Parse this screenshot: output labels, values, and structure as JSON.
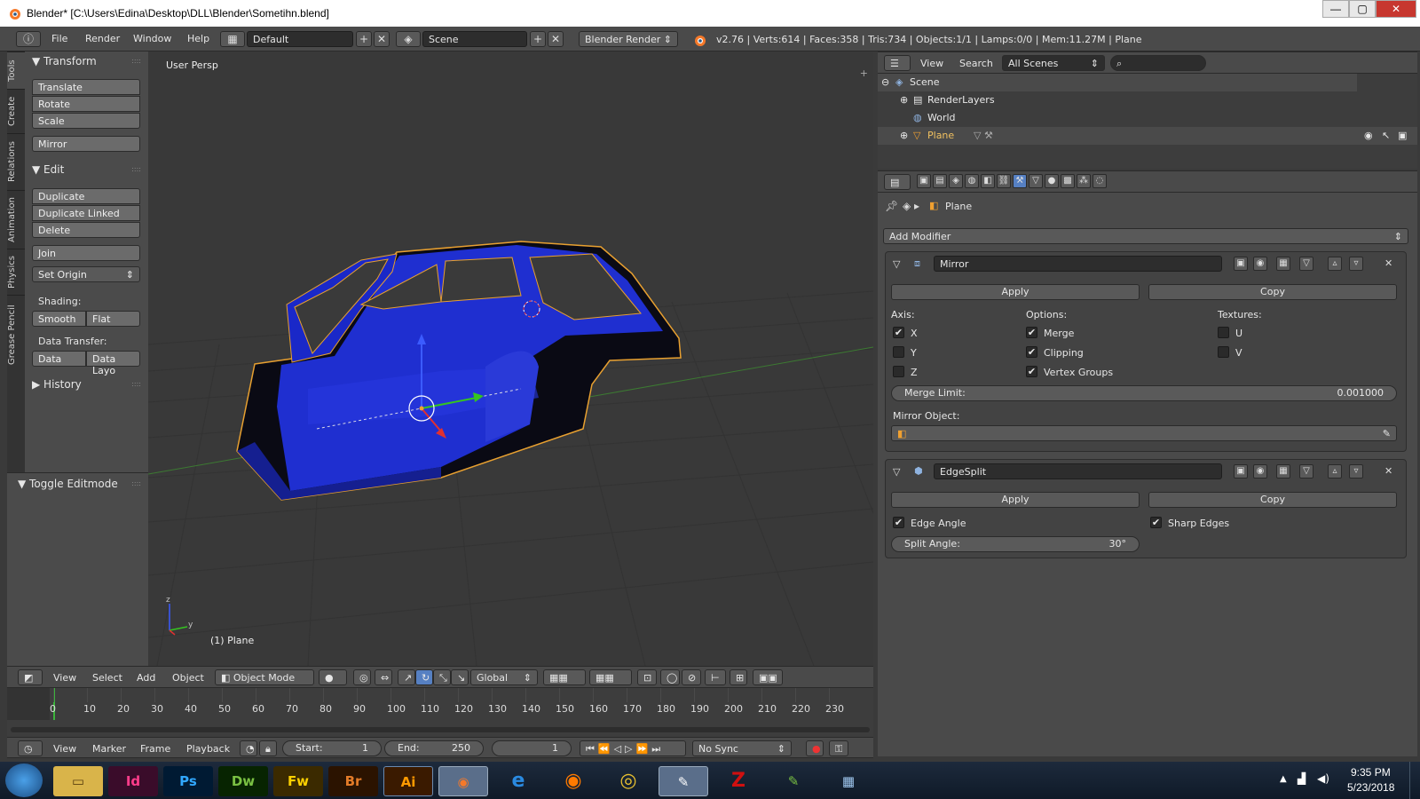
{
  "window": {
    "title": "Blender* [C:\\Users\\Edina\\Desktop\\DLL\\Blender\\Sometihn.blend]",
    "minimize": "—",
    "maximize": "▢",
    "close": "✕"
  },
  "infobar": {
    "menus": [
      "File",
      "Render",
      "Window",
      "Help"
    ],
    "screen_layout": "Default",
    "scene": "Scene",
    "engine": "Blender Render",
    "stats": "v2.76 | Verts:614 | Faces:358 | Tris:734 | Objects:1/1 | Lamps:0/0 | Mem:11.27M | Plane"
  },
  "toolshelf": {
    "tabs": [
      "Tools",
      "Create",
      "Relations",
      "Animation",
      "Physics",
      "Grease Pencil"
    ],
    "transform_title": "Transform",
    "translate": "Translate",
    "rotate": "Rotate",
    "scale": "Scale",
    "mirror": "Mirror",
    "edit_title": "Edit",
    "duplicate": "Duplicate",
    "duplicate_linked": "Duplicate Linked",
    "delete": "Delete",
    "join": "Join",
    "set_origin": "Set Origin",
    "shading_label": "Shading:",
    "smooth": "Smooth",
    "flat": "Flat",
    "data_transfer_label": "Data Transfer:",
    "data": "Data",
    "data_layout": "Data Layo",
    "history_title": "History",
    "toggle_editmode": "Toggle Editmode"
  },
  "viewport": {
    "view_label": "User Persp",
    "object_label": "(1) Plane",
    "axis_y": "y",
    "axis_z": "z"
  },
  "view3d_header": {
    "menus": [
      "View",
      "Select",
      "Add",
      "Object"
    ],
    "mode": "Object Mode",
    "orientation": "Global"
  },
  "timeline": {
    "ticks": [
      "0",
      "10",
      "20",
      "30",
      "40",
      "50",
      "60",
      "70",
      "80",
      "90",
      "100",
      "110",
      "120",
      "130",
      "140",
      "150",
      "160",
      "170",
      "180",
      "190",
      "200",
      "210",
      "220",
      "230"
    ],
    "current_frame_fraction": 0.0,
    "menus": [
      "View",
      "Marker",
      "Frame",
      "Playback"
    ],
    "start_label": "Start:",
    "start_value": "1",
    "end_label": "End:",
    "end_value": "250",
    "current_value": "1",
    "sync": "No Sync"
  },
  "outliner": {
    "view": "View",
    "search": "Search",
    "scenes_filter": "All Scenes",
    "items": [
      "Scene",
      "RenderLayers",
      "World",
      "Plane"
    ]
  },
  "properties": {
    "breadcrumb_object": "Plane",
    "add_modifier": "Add Modifier",
    "mirror": {
      "name": "Mirror",
      "apply": "Apply",
      "copy": "Copy",
      "axis_label": "Axis:",
      "options_label": "Options:",
      "textures_label": "Textures:",
      "x": "X",
      "y": "Y",
      "z": "Z",
      "merge": "Merge",
      "clipping": "Clipping",
      "vertex_groups": "Vertex Groups",
      "u": "U",
      "v": "V",
      "x_checked": true,
      "y_checked": false,
      "z_checked": false,
      "merge_checked": true,
      "clipping_checked": true,
      "vertex_groups_checked": true,
      "u_checked": false,
      "v_checked": false,
      "merge_limit_label": "Merge Limit:",
      "merge_limit_value": "0.001000",
      "mirror_object_label": "Mirror Object:"
    },
    "edgesplit": {
      "name": "EdgeSplit",
      "apply": "Apply",
      "copy": "Copy",
      "edge_angle": "Edge Angle",
      "sharp_edges": "Sharp Edges",
      "edge_angle_checked": true,
      "sharp_edges_checked": true,
      "split_angle_label": "Split Angle:",
      "split_angle_value": "30°"
    }
  },
  "taskbar": {
    "apps": [
      "Id",
      "Ps",
      "Dw",
      "Fw",
      "Br",
      "Ai"
    ],
    "time": "9:35 PM",
    "date": "5/23/2018"
  },
  "colors": {
    "mesh_blue": "#1a28c8",
    "selection_orange": "#f0a030",
    "accent_blue": "#5680c2"
  }
}
